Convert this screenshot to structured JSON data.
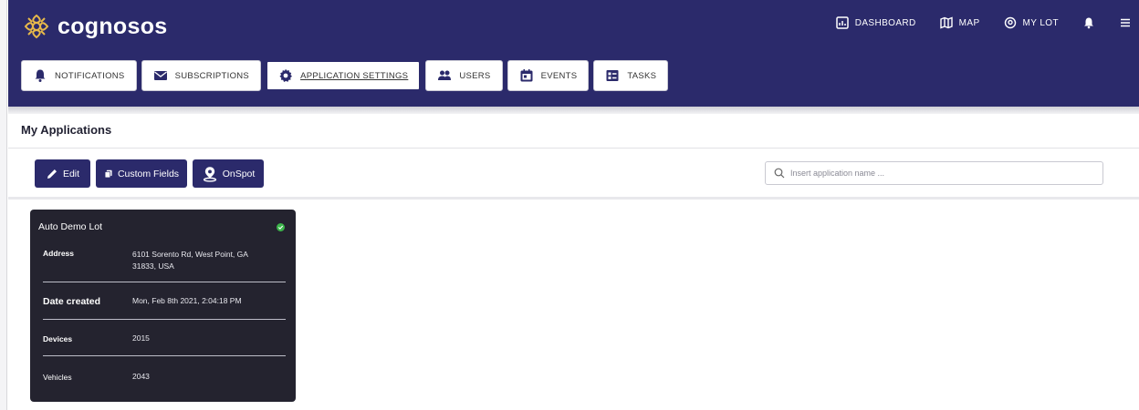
{
  "brand": {
    "name": "cognosos"
  },
  "top_nav": [
    {
      "label": "DASHBOARD",
      "icon": "dashboard-icon"
    },
    {
      "label": "MAP",
      "icon": "map-icon"
    },
    {
      "label": "MY LOT",
      "icon": "location-pin-icon"
    }
  ],
  "top_icons": [
    "bell-icon",
    "hamburger-menu-icon"
  ],
  "tabs": [
    {
      "label": "NOTIFICATIONS",
      "icon": "bell-icon"
    },
    {
      "label": "SUBSCRIPTIONS",
      "icon": "envelope-icon"
    },
    {
      "label": "APPLICATION SETTINGS",
      "icon": "gear-icon",
      "active": true
    },
    {
      "label": "USERS",
      "icon": "users-icon"
    },
    {
      "label": "EVENTS",
      "icon": "calendar-icon"
    },
    {
      "label": "TASKS",
      "icon": "tasks-icon"
    }
  ],
  "section": {
    "title": "My Applications"
  },
  "actions": {
    "edit": "Edit",
    "custom_fields": "Custom Fields",
    "onspot": "OnSpot"
  },
  "search": {
    "placeholder": "Insert application name ...",
    "value": ""
  },
  "card": {
    "title": "Auto Demo Lot",
    "status": "active",
    "status_color": "#3cb44b",
    "address_label": "Address",
    "address_line1": "6101 Sorento Rd, West Point, GA",
    "address_line2": "31833, USA",
    "date_label": "Date created",
    "date_value": "Mon, Feb 8th 2021, 2:04:18 PM",
    "devices_label": "Devices",
    "devices_value": "2015",
    "vehicles_label": "Vehicles",
    "vehicles_value": "2043"
  },
  "colors": {
    "navy": "#2b2a6b",
    "card_bg": "#24232f",
    "logo_gold": "#e8b94a"
  }
}
